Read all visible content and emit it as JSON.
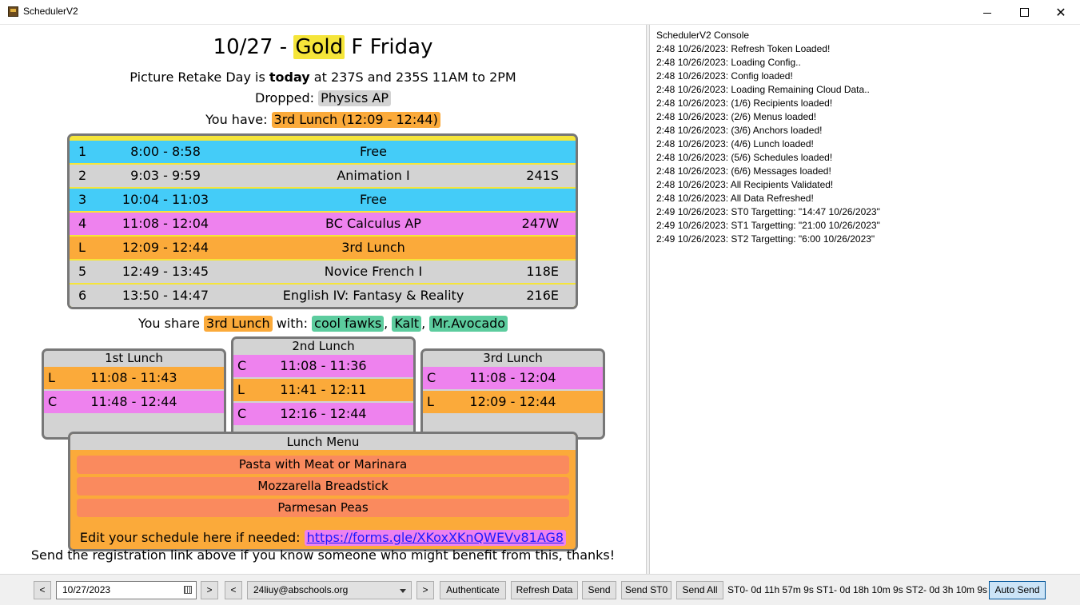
{
  "window": {
    "title": "SchedulerV2"
  },
  "header": {
    "date": "10/27 - ",
    "day_color": "Gold",
    "day_rest": " F Friday",
    "announcement_prefix": "Picture Retake Day is ",
    "announcement_bold": "today",
    "announcement_suffix": " at 237S and 235S 11AM to 2PM",
    "dropped_label": "Dropped: ",
    "dropped_value": "Physics AP",
    "have_label": "You have: ",
    "have_value": "3rd Lunch (12:09 - 12:44)"
  },
  "schedule": [
    {
      "period": "1",
      "time": "8:00 - 8:58",
      "class": "Free",
      "room": "",
      "color": "#44ccf8"
    },
    {
      "period": "2",
      "time": "9:03 - 9:59",
      "class": "Animation I",
      "room": "241S",
      "color": "#d3d3d3"
    },
    {
      "period": "3",
      "time": "10:04 - 11:03",
      "class": "Free",
      "room": "",
      "color": "#44ccf8"
    },
    {
      "period": "4",
      "time": "11:08 - 12:04",
      "class": "BC Calculus AP",
      "room": "247W",
      "color": "#ee82ee"
    },
    {
      "period": "L",
      "time": "12:09 - 12:44",
      "class": "3rd Lunch",
      "room": "",
      "color": "#fbaa3a"
    },
    {
      "period": "5",
      "time": "12:49 - 13:45",
      "class": "Novice French I",
      "room": "118E",
      "color": "#d3d3d3"
    },
    {
      "period": "6",
      "time": "13:50 - 14:47",
      "class": "English IV: Fantasy & Reality",
      "room": "216E",
      "color": "#d3d3d3"
    }
  ],
  "share": {
    "prefix": "You share ",
    "lunch": "3rd Lunch",
    "with": " with: ",
    "friends": [
      "cool fawks",
      "Kalt",
      "Mr.Avocado"
    ],
    "sep": ", "
  },
  "lunches": [
    {
      "title": "1st Lunch",
      "rows": [
        {
          "k": "L",
          "t": "11:08 - 11:43",
          "color": "#fbaa3a"
        },
        {
          "k": "C",
          "t": "11:48 - 12:44",
          "color": "#ee82ee"
        }
      ]
    },
    {
      "title": "2nd Lunch",
      "rows": [
        {
          "k": "C",
          "t": "11:08 - 11:36",
          "color": "#ee82ee"
        },
        {
          "k": "L",
          "t": "11:41 - 12:11",
          "color": "#fbaa3a"
        },
        {
          "k": "C",
          "t": "12:16 - 12:44",
          "color": "#ee82ee"
        }
      ]
    },
    {
      "title": "3rd Lunch",
      "rows": [
        {
          "k": "C",
          "t": "11:08 - 12:04",
          "color": "#ee82ee"
        },
        {
          "k": "L",
          "t": "12:09 - 12:44",
          "color": "#fbaa3a"
        }
      ]
    }
  ],
  "menu": {
    "title": "Lunch Menu",
    "items": [
      "Pasta with Meat or Marinara",
      "Mozzarella Breadstick",
      "Parmesan Peas"
    ]
  },
  "footer": {
    "edit_prefix": "Edit your schedule here if needed: ",
    "edit_link": "https://forms.gle/XKoxXKnQWEVv81AG8",
    "send_text": "Send the registration link above if you know someone who might benefit from this, thanks!"
  },
  "console": {
    "title": "SchedulerV2 Console",
    "lines": [
      "2:48 10/26/2023: Refresh Token Loaded!",
      "2:48 10/26/2023: Loading Config..",
      "2:48 10/26/2023: Config loaded!",
      "2:48 10/26/2023: Loading Remaining Cloud Data..",
      "2:48 10/26/2023: (1/6) Recipients loaded!",
      "2:48 10/26/2023: (2/6) Menus loaded!",
      "2:48 10/26/2023: (3/6) Anchors loaded!",
      "2:48 10/26/2023: (4/6) Lunch loaded!",
      "2:48 10/26/2023: (5/6) Schedules loaded!",
      "2:48 10/26/2023: (6/6) Messages loaded!",
      "2:48 10/26/2023: All Recipients Validated!",
      "2:48 10/26/2023: All Data Refreshed!",
      "2:49 10/26/2023: ST0 Targetting: \"14:47 10/26/2023\"",
      "2:49 10/26/2023: ST1 Targetting: \"21:00 10/26/2023\"",
      "2:49 10/26/2023: ST2 Targetting: \"6:00 10/26/2023\""
    ]
  },
  "toolbar": {
    "prev_date": "<",
    "date_value": "10/27/2023",
    "next_date": ">",
    "prev_user": "<",
    "user_value": "24liuy@abschools.org",
    "next_user": ">",
    "authenticate": "Authenticate",
    "refresh": "Refresh Data",
    "send": "Send",
    "send_st0": "Send ST0",
    "send_all": "Send All",
    "st0": "ST0- 0d 11h 57m 9s",
    "st1": "ST1- 0d 18h 10m 9s",
    "st2": "ST2- 0d 3h 10m 9s",
    "auto_send": "Auto Send"
  }
}
